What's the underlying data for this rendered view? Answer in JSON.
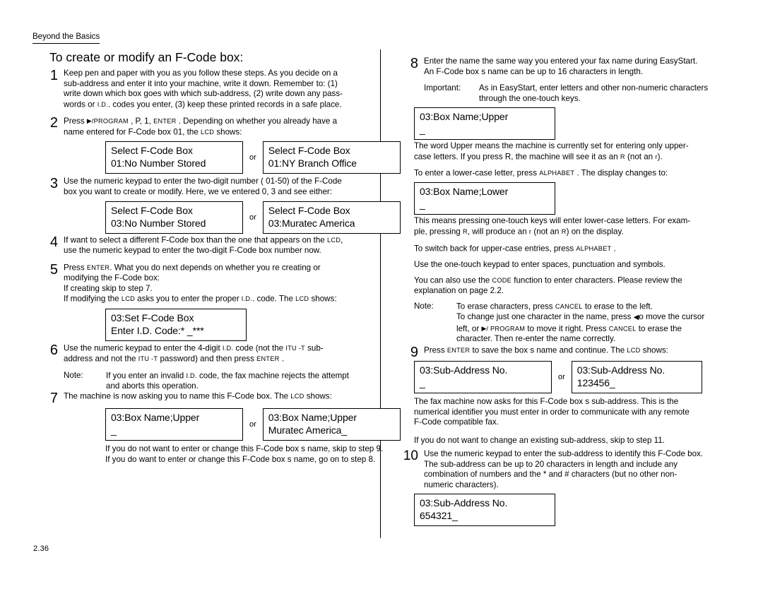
{
  "document": {
    "running_header": "Beyond the Basics",
    "page_number": "2.36",
    "section_title": "To create or modify an F-Code box:"
  },
  "left_column": {
    "step1": {
      "number": "1",
      "lines": [
        "Keep pen and paper with you as you follow these steps. As you decide on a",
        "sub-address and enter it into your machine, write it down. Remember to:    (1)",
        "write down which box goes with which sub-address,    (2) write down any pass-",
        "words or I.D. codes you enter, (3) keep these printed records in a safe place."
      ],
      "line4_pre": "words or ",
      "line4_kc": "I.D.",
      "line4_post": ". codes you enter, (3) keep these printed records in a safe place."
    },
    "step2": {
      "number": "2",
      "press_label": "Press",
      "key_program": "/PROGRAM",
      "keys_mid": ", P, 1,",
      "key_enter": "ENTER",
      "text_after": ". Depending on whether you already have a",
      "line2_pre": "name entered for F-Code box  01, the ",
      "line2_kc": "LCD",
      "line2_post": " shows:"
    },
    "lcd_pair_1": {
      "or_label": "or",
      "left": {
        "line1": "Select F-Code Box",
        "line2": "01:No Number Stored"
      },
      "right": {
        "line1": "Select F-Code Box",
        "line2": "01:NY Branch Office"
      }
    },
    "step3": {
      "number": "3",
      "line1": "Use the numeric keypad to enter the two-digit number (    01-50) of the F-Code",
      "line2": "box you want to create or modify. Here, we ve entered    0, 3 and see either:"
    },
    "lcd_pair_2": {
      "or_label": "or",
      "left": {
        "line1": "Select F-Code Box",
        "line2": "03:No Number Stored"
      },
      "right": {
        "line1": "Select F-Code Box",
        "line2": "03:Muratec America"
      }
    },
    "step4": {
      "number": "4",
      "line1_pre": "If want to select a different F-Code box than the one that appears on the ",
      "line1_kc": "LCD",
      "line1_post": ",",
      "line2": "use the numeric keypad to enter the two-digit F-Code box number now."
    },
    "step5": {
      "number": "5",
      "press_label": "Press ",
      "key_enter": "ENTER",
      "line1_post": ". What you do next depends on whether you re creating or",
      "line2": "modifying the F-Code box:",
      "line3": "If creating   skip to step 7.",
      "line4_pre": "If modifying   the   ",
      "line4_kc1": "LCD",
      "line4_mid": " asks you to enter the proper  ",
      "line4_kc2": "I.D.",
      "line4_mid2": ". code. The ",
      "line4_kc3": "LCD",
      "line4_post": " shows:"
    },
    "lcd_single_1": {
      "line1": "03:Set F-Code Box",
      "line2": "Enter I.D. Code:*       _***"
    },
    "step6": {
      "number": "6",
      "line1_pre": "Use the numeric keypad to enter the 4-digit    ",
      "line1_kc1": "I.D.",
      "line1_mid": " code (not the ",
      "line1_kc2": "ITU -T",
      "line1_post": " sub-",
      "line2_pre": "address and not the ",
      "line2_kc1": "ITU -T",
      "line2_mid": " password) and then press ",
      "line2_kc2": "ENTER",
      "line2_post": " .",
      "note_label": "Note:",
      "note_line1_pre": "If you enter an invalid    ",
      "note_line1_kc": "I.D.",
      "note_line1_post": " code, the fax machine rejects the attempt",
      "note_line2": "and aborts this operation."
    },
    "step7": {
      "number": "7",
      "line1_pre": "The machine is now asking you to name this F-Code box. The   ",
      "line1_kc": "LCD",
      "line1_post": " shows:"
    },
    "lcd_pair_3": {
      "or_label": "or",
      "left": {
        "line1": "03:Box Name;Upper",
        "line2": "_"
      },
      "right": {
        "line1": "03:Box Name;Upper",
        "line2": "Muratec America_"
      }
    },
    "step7_after": {
      "line1": "If you do not want to enter or change this F-Code box s name, skip to step 9.",
      "line2": "If you do want to enter or change this F-Code box s name, go on to step 8."
    }
  },
  "right_column": {
    "step8": {
      "number": "8",
      "line1": "Enter the name the same way you entered your fax name during EasyStart.",
      "line2": "An F-Code box s name can be up to 16 characters in length.",
      "important_label": "Important:",
      "important_line1": "As in EasyStart, enter letters and other non-numeric characters",
      "important_line2": "through the one-touch keys."
    },
    "lcd_single_2": {
      "line1": "03:Box Name;Upper",
      "line2": "_"
    },
    "para_upper": {
      "line1": "The word  Upper  means the machine is currently set for entering only upper-",
      "line2_pre": "case letters. If you press R, the machine will see it as an     ",
      "line2_kc1": "R",
      "line2_mid": " (not an ",
      "line2_kc2": "r",
      "line2_post": ")."
    },
    "para_lower_intro": {
      "pre": "To enter a lower-case letter, press  ",
      "kc": "ALPHABET",
      "post": " . The display changes to:"
    },
    "lcd_single_3": {
      "line1": "03:Box Name;Lower",
      "line2": "_"
    },
    "para_lowercase": {
      "line1": "This means pressing one-touch keys will enter lower-case letters. For exam-",
      "line2_pre": "ple, pressing  ",
      "line2_kc1": "R",
      "line2_mid": ", will produce an   ",
      "line2_kc2": "r",
      "line2_mid2": " (not an ",
      "line2_kc3": "R",
      "line2_post": ") on the display."
    },
    "para_switch_back": {
      "pre": "To switch back for upper-case entries, press  ",
      "kc": "ALPHABET",
      "post": " ."
    },
    "para_onetouch": "Use the one-touch keypad to enter spaces, punctuation and symbols.",
    "para_code": {
      "line1_pre": "You can also use the ",
      "line1_kc": "CODE",
      "line1_post": " function to enter characters. Please review the",
      "line2": "explanation on page 2.2."
    },
    "note_erase": {
      "label": "Note:",
      "line1_pre": "To erase characters, press ",
      "line1_kc": "CANCEL",
      "line1_post": " to erase to the left.",
      "line2_pre": "To change just one character in the name, press   ",
      "line2_arrow": "◀",
      "line2_post": "o move the cursor",
      "line3_pre": "left, or  ",
      "line3_arrow": "▶",
      "line3_kc1": "/ PROGRAM",
      "line3_mid": "  to move it right. Press  ",
      "line3_kc2": "CANCEL",
      "line3_post": " to erase the",
      "line4": "character. Then re-enter the name correctly."
    },
    "step9": {
      "number": "9",
      "pre": "Press ",
      "kc1": "ENTER",
      "mid": " to save the box s name and continue. The  ",
      "kc2": "LCD",
      "post": " shows:"
    },
    "lcd_pair_4": {
      "or_label": "or",
      "left": {
        "line1": "03:Sub-Address No.",
        "line2": "_"
      },
      "right": {
        "line1": "03:Sub-Address No.",
        "line2": "123456_"
      }
    },
    "para_subaddr": {
      "line1": "The fax machine now asks for this F-Code box s sub-address. This is the",
      "line2": "numerical identifier you must enter in order to communicate with any remote",
      "line3": "F-Code compatible fax."
    },
    "para_skip11": "If you do not want to change an existing sub-address, skip to step 11.",
    "step10": {
      "number": "10",
      "line1": "Use the numeric keypad to enter the sub-address to identify this F-Code box.",
      "line2": "The sub-address can be up to 20 characters in length and include any",
      "line3": "combination of numbers and the * and # characters (but no other non-",
      "line4": "numeric characters)."
    },
    "lcd_single_4": {
      "line1": "03:Sub-Address No.",
      "line2": "654321_"
    }
  }
}
